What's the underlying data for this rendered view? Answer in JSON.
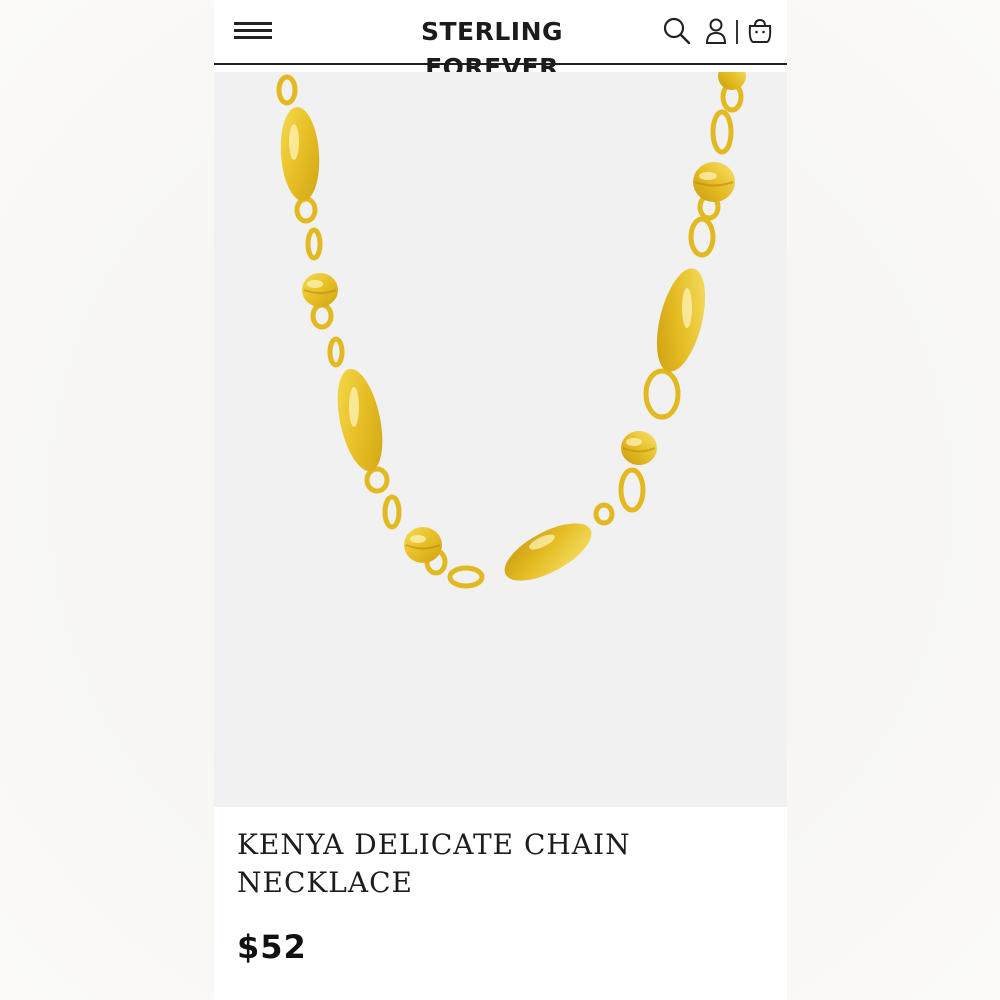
{
  "header": {
    "brand": "STERLING FOREVER",
    "icons": [
      "menu-icon",
      "search-icon",
      "account-icon",
      "bag-icon"
    ]
  },
  "product": {
    "image_alt": "gold chain necklace",
    "title": "KENYA DELICATE CHAIN NECKLACE",
    "price": "$52"
  },
  "colors": {
    "gold": "#e8c52a",
    "gold_dark": "#c9a012",
    "image_bg": "#f1f1f2",
    "text": "#1d1d1d"
  }
}
